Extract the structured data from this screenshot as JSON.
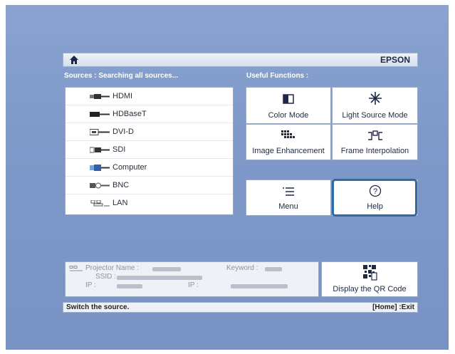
{
  "header": {
    "brand": "EPSON",
    "home_icon": "home-icon"
  },
  "sources": {
    "title": "Sources : Searching all sources...",
    "items": [
      {
        "label": "HDMI",
        "icon": "hdmi-connector-icon"
      },
      {
        "label": "HDBaseT",
        "icon": "hdbaset-connector-icon"
      },
      {
        "label": "DVI-D",
        "icon": "dvi-connector-icon"
      },
      {
        "label": "SDI",
        "icon": "sdi-connector-icon"
      },
      {
        "label": "Computer",
        "icon": "vga-connector-icon"
      },
      {
        "label": "BNC",
        "icon": "bnc-connector-icon"
      },
      {
        "label": "LAN",
        "icon": "lan-icon"
      }
    ]
  },
  "functions": {
    "title": "Useful Functions :",
    "color_mode": "Color Mode",
    "light_source_mode": "Light Source Mode",
    "image_enhancement": "Image Enhancement",
    "frame_interpolation": "Frame Interpolation",
    "menu": "Menu",
    "help": "Help"
  },
  "network": {
    "projector_name_label": "Projector Name :",
    "keyword_label": "Keyword :",
    "ssid_label": "SSID :",
    "ip_label": "IP :",
    "wired_ip_label": "IP :"
  },
  "qr": {
    "label": "Display the QR Code"
  },
  "status": {
    "hint": "Switch the source.",
    "exit": "[Home] :Exit"
  },
  "colors": {
    "background": "#8aa3d0",
    "selection": "#2f6aa6"
  }
}
